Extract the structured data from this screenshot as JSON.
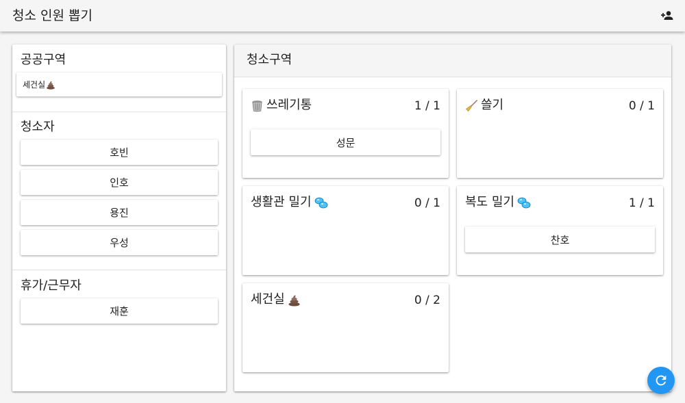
{
  "appbar": {
    "title": "청소 인원 뽑기",
    "action_icon": "person-add-icon"
  },
  "left": {
    "public_zone": {
      "title": "공공구역",
      "items": [
        {
          "label": "세건실",
          "icon": "poop-icon"
        }
      ]
    },
    "cleaners": {
      "title": "청소자",
      "people": [
        "호빈",
        "인호",
        "용진",
        "우성"
      ]
    },
    "off_duty": {
      "title": "휴가/근무자",
      "people": [
        "재훈"
      ]
    }
  },
  "right": {
    "title": "청소구역",
    "zones": [
      {
        "name": "쓰레기통",
        "icon": "trash-can-icon",
        "count": "1 / 1",
        "assignees": [
          "성문"
        ]
      },
      {
        "name": "쓸기",
        "icon": "broom-icon",
        "count": "0 / 1",
        "assignees": []
      },
      {
        "name": "생활관 밀기",
        "icon": "bubbles-icon",
        "count": "0 / 1",
        "assignees": []
      },
      {
        "name": "복도 밀기",
        "icon": "bubbles-icon",
        "count": "1 / 1",
        "assignees": [
          "찬호"
        ]
      },
      {
        "name": "세건실",
        "icon": "poop-icon",
        "count": "0 / 2",
        "assignees": []
      }
    ]
  },
  "fab": {
    "icon": "refresh-icon"
  },
  "colors": {
    "accent": "#2196f3",
    "background": "#f5f5f5",
    "card": "#ffffff"
  }
}
